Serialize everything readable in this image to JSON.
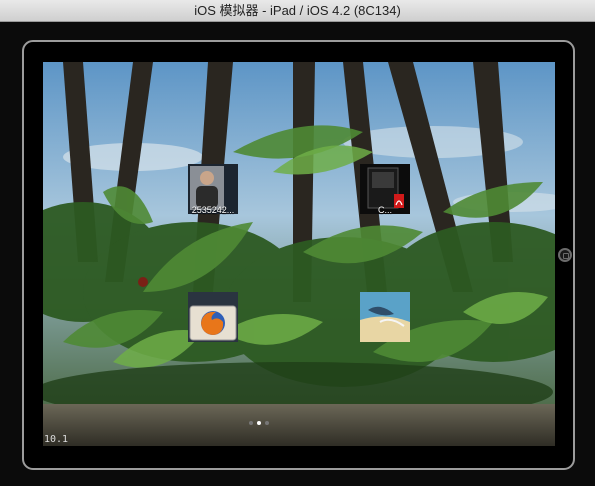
{
  "window": {
    "title": "iOS 模拟器 - iPad / iOS 4.2 (8C134)"
  },
  "home_screen": {
    "icons": [
      {
        "label": "2535242...",
        "kind": "photo-thumbnail"
      },
      {
        "label": "C...",
        "kind": "pdf-document"
      },
      {
        "label": "",
        "kind": "firefox-app"
      },
      {
        "label": "",
        "kind": "beach-image"
      }
    ],
    "page_indicator": {
      "pages": 3,
      "current": 2
    },
    "version_text": "10.1"
  },
  "colors": {
    "titlebar": "#dcdcdc",
    "bezel": "#000000",
    "bezel_border": "#9c9c9c"
  }
}
